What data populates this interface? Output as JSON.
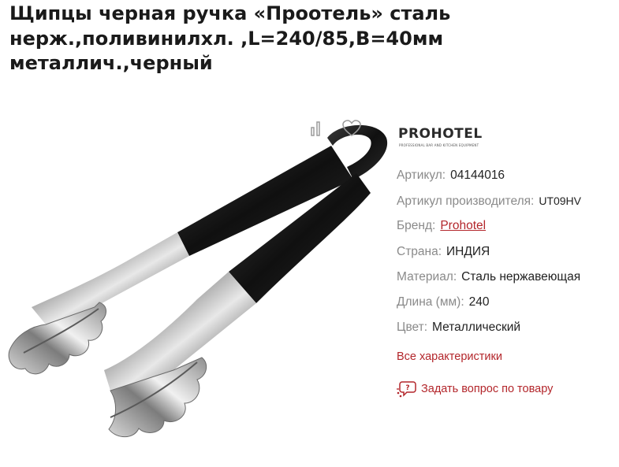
{
  "product": {
    "title_lines": [
      "Щипцы черная ручка «Проотель» сталь",
      "нерж.,поливинилхл. ,L=240/85,B=40мм",
      "металлич.,черный"
    ]
  },
  "actions": {
    "compare_icon": "compare-icon",
    "favorite_icon": "heart-icon"
  },
  "brand_logo": {
    "name": "PROHOTEL",
    "tagline": "PROFESSIONAL BAR AND KITCHEN EQUIPMENT"
  },
  "specs": [
    {
      "key": "Артикул:",
      "value": "04144016"
    },
    {
      "key": "Артикул производителя:",
      "value": "UT09HV"
    },
    {
      "key": "Бренд:",
      "value": "Prohotel"
    },
    {
      "key": "Страна:",
      "value": "ИНДИЯ"
    },
    {
      "key": "Материал:",
      "value": "Сталь нержавеющая"
    },
    {
      "key": "Длина (мм):",
      "value": "240"
    },
    {
      "key": "Цвет:",
      "value": "Металлический"
    }
  ],
  "links": {
    "all_specs": "Все характеристики",
    "ask_question": "Задать вопрос по товару"
  },
  "colors": {
    "accent": "#b3262b",
    "label": "#8a8a8a",
    "text": "#222222"
  }
}
